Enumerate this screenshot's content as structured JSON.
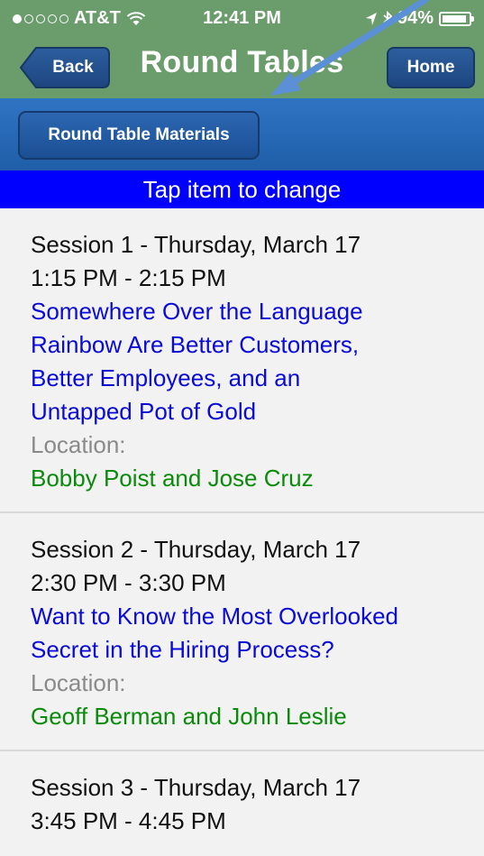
{
  "status_bar": {
    "carrier": "AT&T",
    "time": "12:41 PM",
    "battery": "94%",
    "battery_level": 0.94
  },
  "nav": {
    "back_label": "Back",
    "title": "Round Tables",
    "home_label": "Home"
  },
  "toolbar": {
    "materials_label": "Round Table Materials"
  },
  "banner": {
    "text": "Tap item to change"
  },
  "sessions": [
    {
      "session": "Session 1 - Thursday, March 17",
      "time": "1:15 PM - 2:15 PM",
      "title_lines": [
        "Somewhere Over the Language",
        "Rainbow Are Better Customers,",
        "Better Employees, and an",
        "Untapped Pot of Gold"
      ],
      "location_label": "Location:",
      "presenters": "Bobby Poist and Jose Cruz"
    },
    {
      "session": "Session 2 - Thursday, March 17",
      "time": "2:30 PM - 3:30 PM",
      "title_lines": [
        "Want to Know the Most Overlooked",
        "Secret in the Hiring Process?"
      ],
      "location_label": "Location:",
      "presenters": "Geoff Berman and John Leslie"
    },
    {
      "session": "Session 3 - Thursday, March 17",
      "time": "3:45 PM - 4:45 PM"
    }
  ],
  "colors": {
    "nav_green": "#6a9c6c",
    "toolbar_blue": "#2f74c3",
    "banner_blue": "#0000ff",
    "link_blue": "#0a0ad8",
    "presenter_green": "#0a8a0a",
    "annotation_arrow": "#5b8fd6"
  },
  "icons": [
    "signal-dots-icon",
    "wifi-icon",
    "location-arrow-icon",
    "bluetooth-icon",
    "battery-icon",
    "back-chevron-icon",
    "annotation-arrow-icon"
  ]
}
